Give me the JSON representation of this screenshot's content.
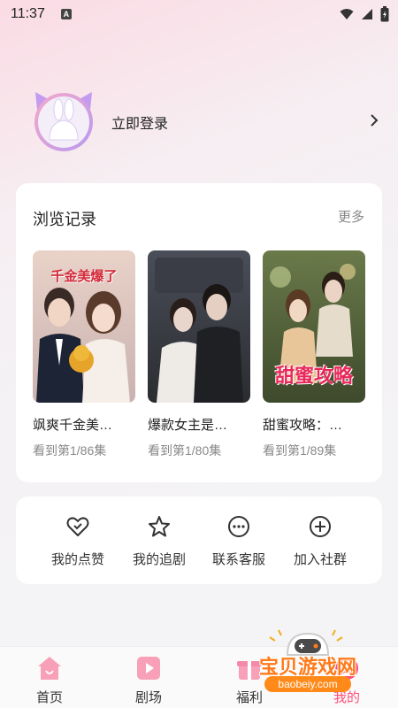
{
  "status_bar": {
    "time": "11:37",
    "notification_letter": "A"
  },
  "profile": {
    "login_label": "立即登录"
  },
  "history": {
    "title": "浏览记录",
    "more_label": "更多",
    "items": [
      {
        "title": "飒爽千金美…",
        "progress": "看到第1/86集",
        "poster_text": "千金美爆了"
      },
      {
        "title": "爆款女主是…",
        "progress": "看到第1/80集",
        "poster_text": ""
      },
      {
        "title": "甜蜜攻略：…",
        "progress": "看到第1/89集",
        "poster_text": "甜蜜攻略"
      }
    ]
  },
  "actions": [
    {
      "label": "我的点赞",
      "icon": "heart-check-icon"
    },
    {
      "label": "我的追剧",
      "icon": "star-icon"
    },
    {
      "label": "联系客服",
      "icon": "chat-bubble-icon"
    },
    {
      "label": "加入社群",
      "icon": "plus-circle-icon"
    }
  ],
  "nav": [
    {
      "label": "首页",
      "icon": "home-icon"
    },
    {
      "label": "剧场",
      "icon": "theater-play-icon"
    },
    {
      "label": "福利",
      "icon": "gift-icon"
    },
    {
      "label": "我的",
      "icon": "profile-icon",
      "active": true
    }
  ],
  "watermark": {
    "text": "宝贝游戏网",
    "url": "baobeiy.com"
  },
  "colors": {
    "accent": "#ff4d7a",
    "avatar_purple": "#c39bf0",
    "avatar_pink": "#f6a8c8"
  }
}
